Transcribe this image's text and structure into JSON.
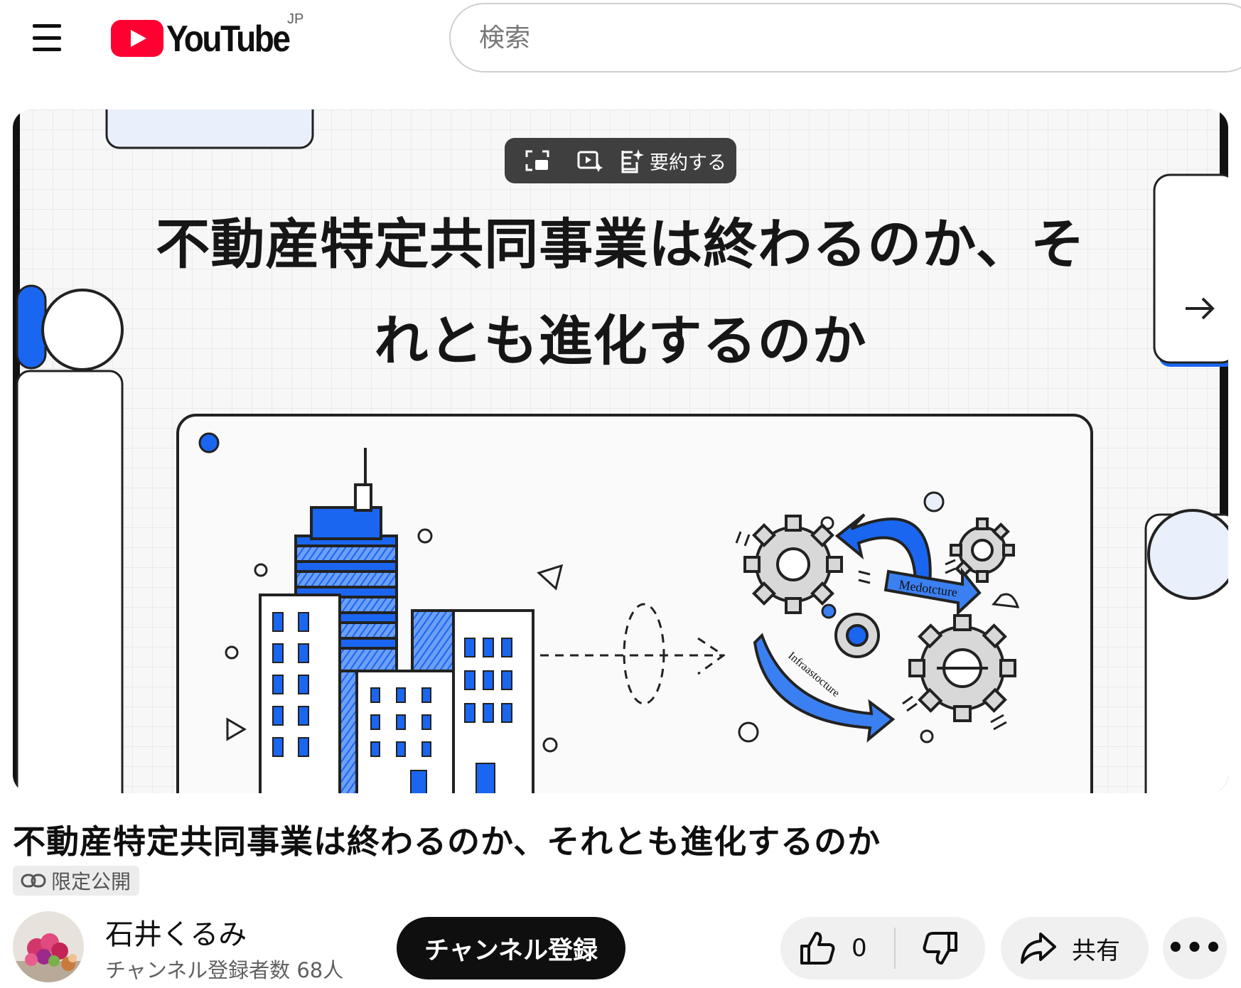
{
  "header": {
    "logo_text": "YouTube",
    "region": "JP",
    "search_placeholder": "検索"
  },
  "player": {
    "overlay": {
      "summarize_label": "要約する"
    },
    "slide": {
      "title_line1": "不動産特定共同事業は終わるのか、そ",
      "title_line2": "れとも進化するのか",
      "illustration_labels": [
        "Medotcture",
        "Infraastocture"
      ]
    }
  },
  "video": {
    "title": "不動産特定共同事業は終わるのか、それとも進化するのか",
    "privacy": "限定公開"
  },
  "channel": {
    "name": "石井くるみ",
    "subscribers": "チャンネル登録者数 68人",
    "subscribe_label": "チャンネル登録"
  },
  "actions": {
    "like_count": "0",
    "share_label": "共有",
    "more_label": "•••"
  },
  "colors": {
    "brand_red": "#ff0033",
    "accent_blue": "#1a66f0",
    "subscribe_bg": "#0f0f0f"
  }
}
